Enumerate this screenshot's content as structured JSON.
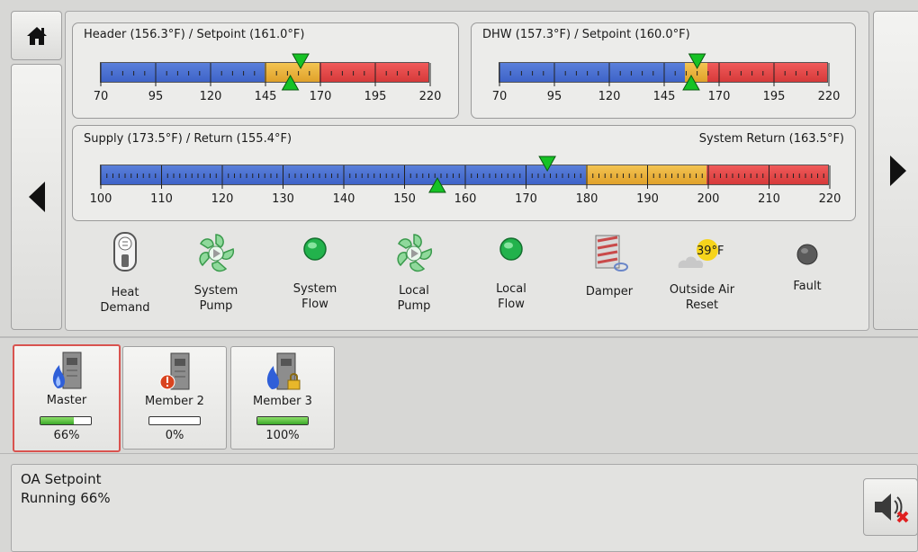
{
  "nav": {
    "home_icon": "home-icon",
    "left_icon": "arrow-left-icon",
    "right_icon": "arrow-right-icon"
  },
  "gauges": {
    "header": {
      "label": "Header (156.3°F) / Setpoint (161.0°F)",
      "min": 70,
      "max": 220,
      "ticks": [
        "70",
        "95",
        "120",
        "145",
        "170",
        "195",
        "220"
      ],
      "zones": [
        {
          "from": 70,
          "to": 145,
          "color": "blue"
        },
        {
          "from": 145,
          "to": 170,
          "color": "orange"
        },
        {
          "from": 170,
          "to": 220,
          "color": "red"
        }
      ],
      "actual": 156.3,
      "setpoint": 161.0
    },
    "dhw": {
      "label": "DHW (157.3°F) / Setpoint (160.0°F)",
      "min": 70,
      "max": 220,
      "ticks": [
        "70",
        "95",
        "120",
        "145",
        "170",
        "195",
        "220"
      ],
      "zones": [
        {
          "from": 70,
          "to": 155,
          "color": "blue"
        },
        {
          "from": 155,
          "to": 165,
          "color": "orange"
        },
        {
          "from": 165,
          "to": 220,
          "color": "red"
        }
      ],
      "actual": 157.3,
      "setpoint": 160.0
    },
    "supply": {
      "label": "Supply (173.5°F) / Return (155.4°F)",
      "label_right": "System Return (163.5°F)",
      "min": 100,
      "max": 220,
      "ticks": [
        "100",
        "110",
        "120",
        "130",
        "140",
        "150",
        "160",
        "170",
        "180",
        "190",
        "200",
        "210",
        "220"
      ],
      "zones": [
        {
          "from": 100,
          "to": 180,
          "color": "blue"
        },
        {
          "from": 180,
          "to": 200,
          "color": "orange"
        },
        {
          "from": 200,
          "to": 220,
          "color": "red"
        }
      ],
      "actual": 155.4,
      "setpoint": 173.5
    }
  },
  "status_icons": [
    {
      "label": "Heat Demand",
      "icon": "heat-demand-switch-icon"
    },
    {
      "label": "System Pump",
      "icon": "pump-icon"
    },
    {
      "label": "System Flow",
      "icon": "green-led-icon"
    },
    {
      "label": "Local Pump",
      "icon": "pump-icon"
    },
    {
      "label": "Local Flow",
      "icon": "green-led-icon"
    },
    {
      "label": "Damper",
      "icon": "damper-icon"
    },
    {
      "label": "Outside Air Reset",
      "icon": "outside-air-icon",
      "temp": "39°F"
    },
    {
      "label": "Fault",
      "icon": "gray-led-icon"
    }
  ],
  "modules": [
    {
      "name": "Master",
      "percent": "66%",
      "fill": 0.66,
      "selected": true,
      "icon": "boiler-flame-icon"
    },
    {
      "name": "Member 2",
      "percent": "0%",
      "fill": 0.0,
      "selected": false,
      "icon": "boiler-fault-icon"
    },
    {
      "name": "Member 3",
      "percent": "100%",
      "fill": 1.0,
      "selected": false,
      "icon": "boiler-locked-icon"
    }
  ],
  "status": {
    "line1": "OA Setpoint",
    "line2": "Running 66%"
  },
  "mute_icon": "speaker-mute-icon",
  "colors": {
    "blue": "#3e63c8",
    "orange": "#e0a12a",
    "red": "#d63a3a",
    "green_led": "#22c55e",
    "selected_border": "#d9534f"
  }
}
